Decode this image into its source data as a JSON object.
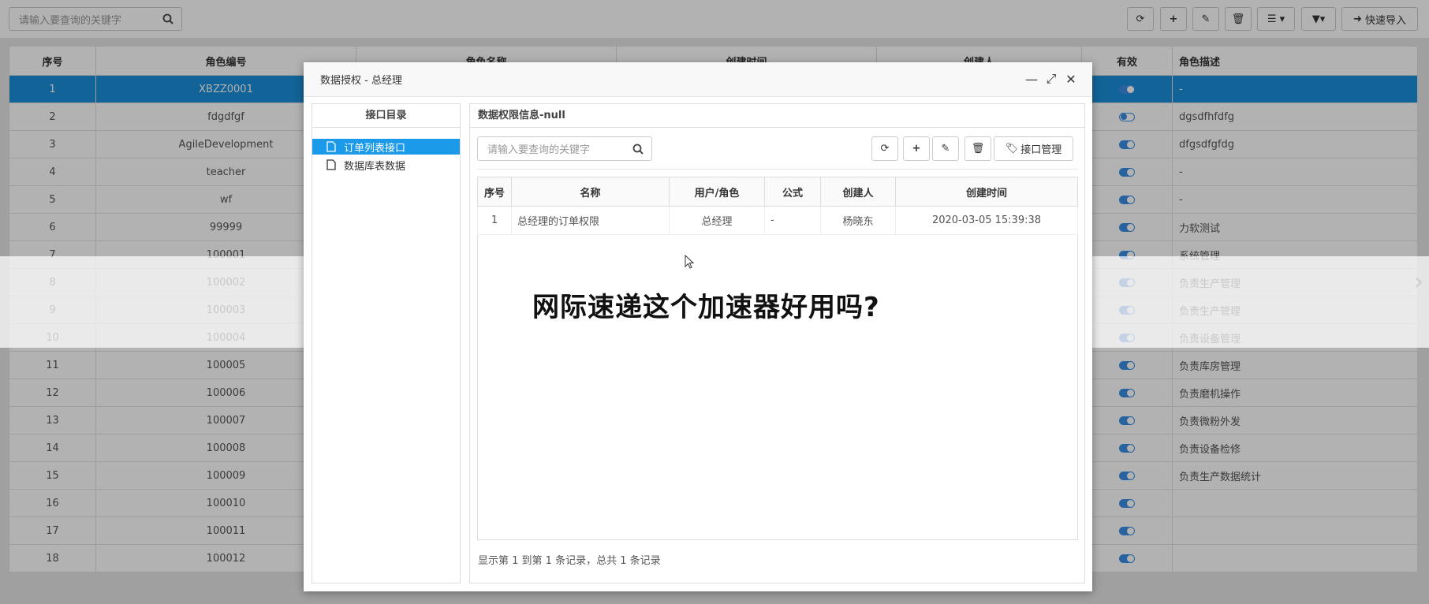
{
  "toolbar": {
    "search_placeholder": "请输入要查询的关键字",
    "quick_import_label": "快速导入"
  },
  "table": {
    "headers": [
      "序号",
      "角色编号",
      "角色名称",
      "创建时间",
      "创建人",
      "有效",
      "角色描述"
    ],
    "rows": [
      {
        "no": "1",
        "code": "XBZZ0001",
        "desc": "-",
        "on": true
      },
      {
        "no": "2",
        "code": "fdgdfgf",
        "desc": "dgsdfhfdfg",
        "on": false
      },
      {
        "no": "3",
        "code": "AgileDevelopment",
        "desc": "dfgsdfgfdg",
        "on": true
      },
      {
        "no": "4",
        "code": "teacher",
        "desc": "-",
        "on": true
      },
      {
        "no": "5",
        "code": "wf",
        "desc": "-",
        "on": true
      },
      {
        "no": "6",
        "code": "99999",
        "desc": "力软测试",
        "on": true
      },
      {
        "no": "7",
        "code": "100001",
        "desc": "系统管理",
        "on": true
      },
      {
        "no": "8",
        "code": "100002",
        "desc": "负责生产管理",
        "on": true
      },
      {
        "no": "9",
        "code": "100003",
        "desc": "负责生产管理",
        "on": true
      },
      {
        "no": "10",
        "code": "100004",
        "desc": "负责设备管理",
        "on": true
      },
      {
        "no": "11",
        "code": "100005",
        "desc": "负责库房管理",
        "on": true
      },
      {
        "no": "12",
        "code": "100006",
        "desc": "负责磨机操作",
        "on": true
      },
      {
        "no": "13",
        "code": "100007",
        "desc": "负责微粉外发",
        "on": true
      },
      {
        "no": "14",
        "code": "100008",
        "desc": "负责设备检修",
        "on": true
      },
      {
        "no": "15",
        "code": "100009",
        "desc": "负责生产数据统计",
        "on": true
      },
      {
        "no": "16",
        "code": "100010",
        "desc": "",
        "on": true
      },
      {
        "no": "17",
        "code": "100011",
        "desc": "",
        "on": true
      },
      {
        "no": "18",
        "code": "100012",
        "desc": "",
        "on": true
      }
    ]
  },
  "modal": {
    "title": "数据授权 - 总经理",
    "left_panel_title": "接口目录",
    "tree": [
      "订单列表接口",
      "数据库表数据"
    ],
    "right_panel_title": "数据权限信息-null",
    "search_placeholder": "请输入要查询的关键字",
    "api_manage_label": "接口管理",
    "grid_headers": [
      "序号",
      "名称",
      "用户/角色",
      "公式",
      "创建人",
      "创建时间"
    ],
    "grid_rows": [
      [
        "1",
        "总经理的订单权限",
        "总经理",
        "-",
        "杨晓东",
        "2020-03-05 15:39:38"
      ]
    ],
    "footer": "显示第 1 到第 1 条记录，总共 1 条记录"
  },
  "watermark": "网际速递这个加速器好用吗?"
}
